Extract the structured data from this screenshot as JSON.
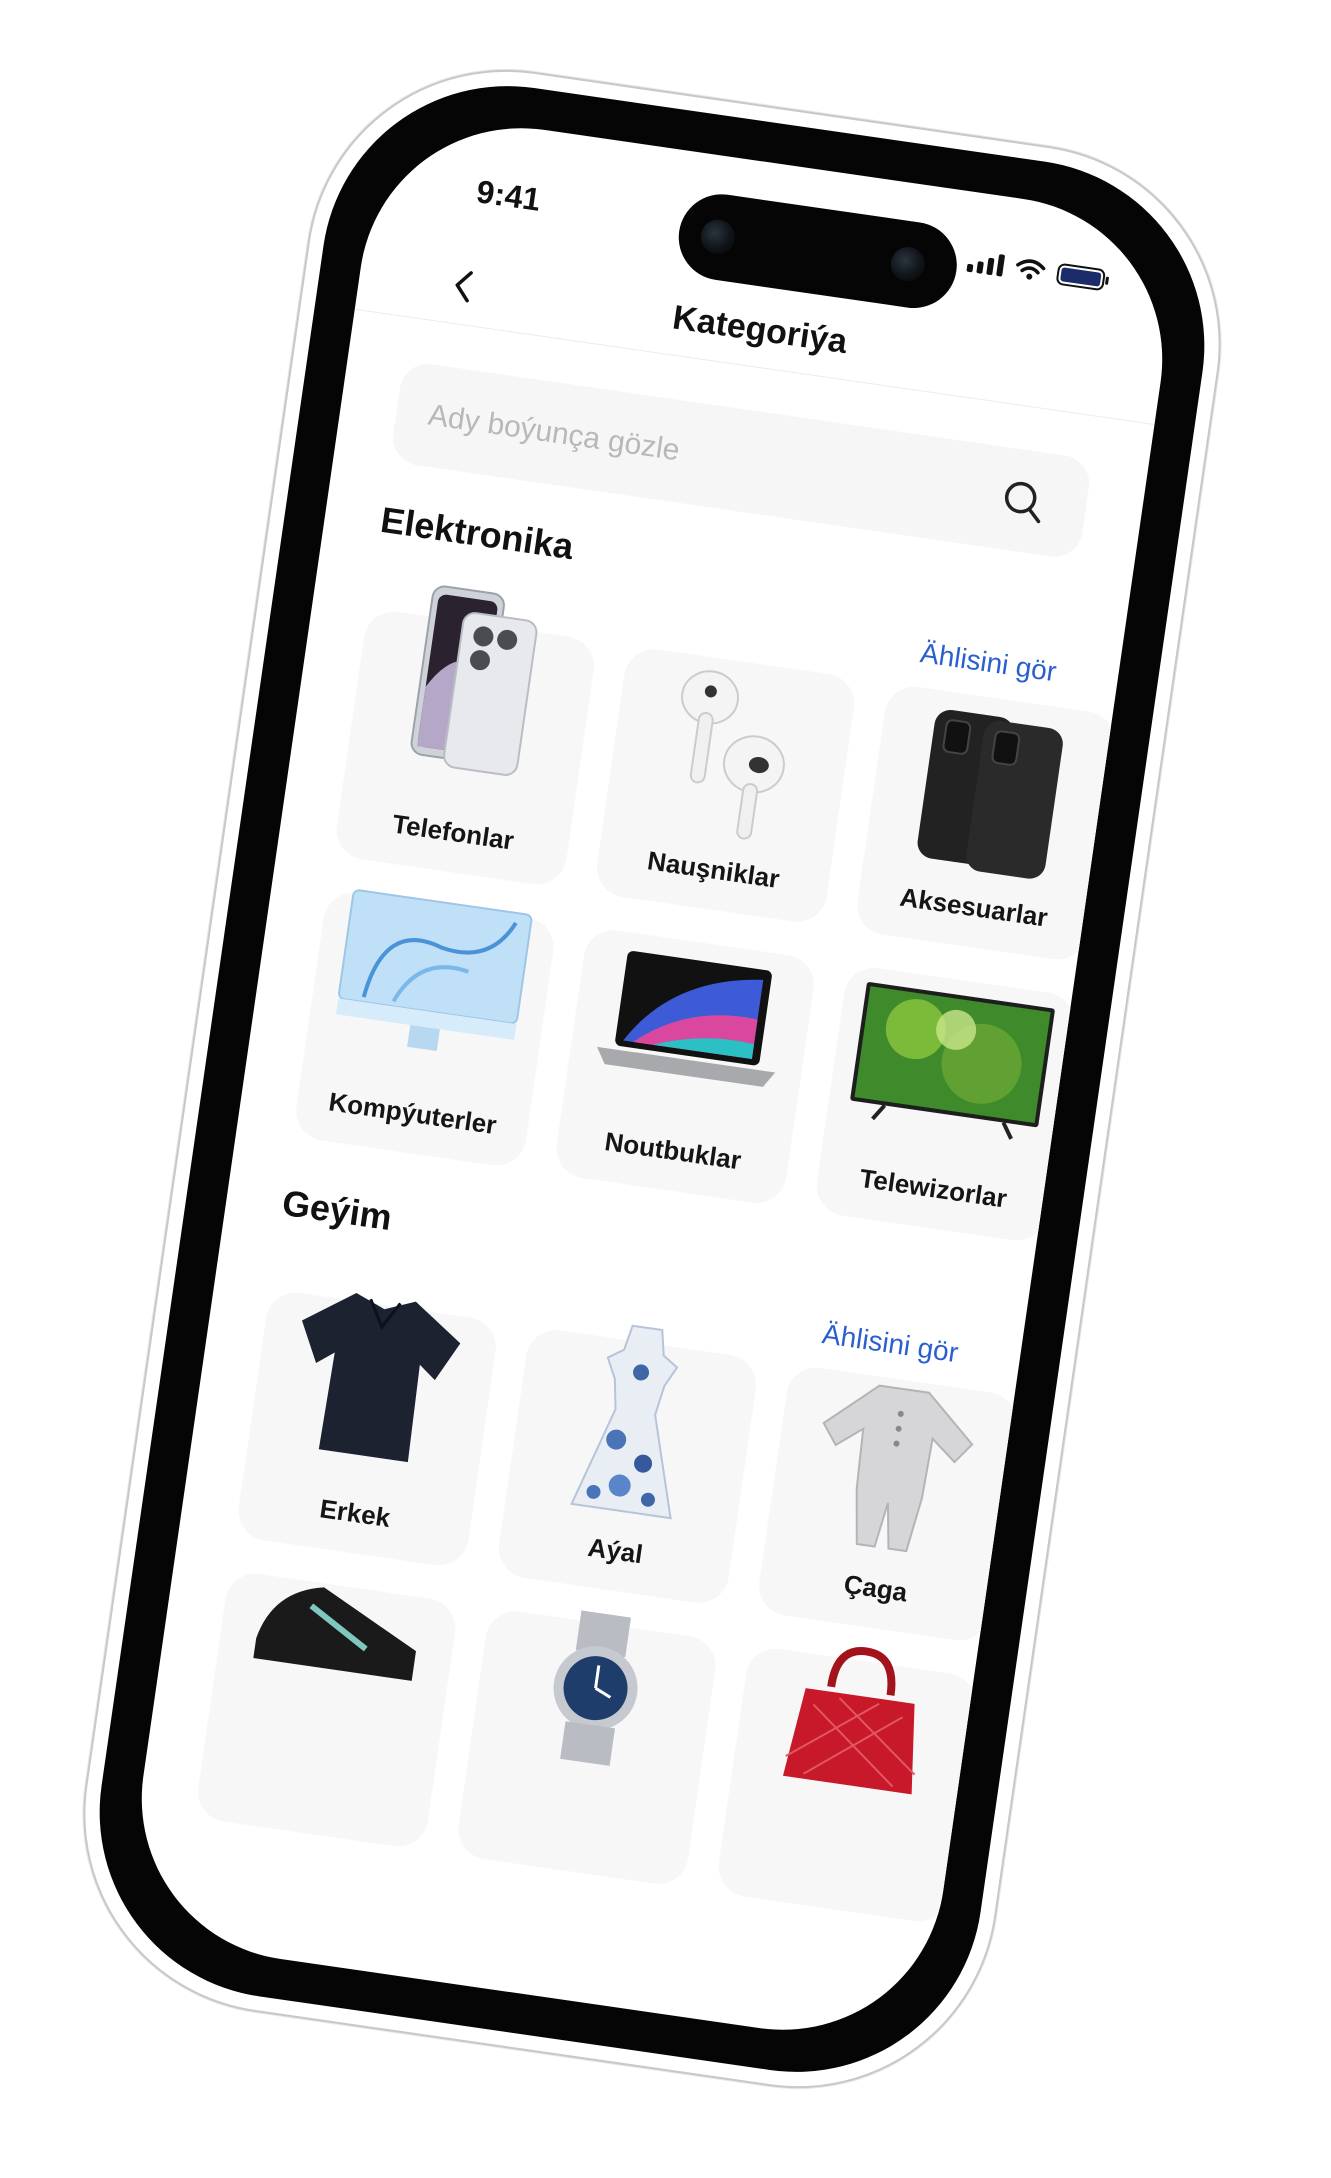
{
  "status_bar": {
    "time": "9:41"
  },
  "nav": {
    "title": "Kategoriýa",
    "back_icon": "chevron-left-icon"
  },
  "search": {
    "placeholder": "Ady boýunça gözle",
    "value": "",
    "icon": "search-icon"
  },
  "sections": [
    {
      "title": "Elektronika",
      "see_all": "Ählisini gör",
      "items": [
        {
          "label": "Telefonlar",
          "icon": "smartphone-image"
        },
        {
          "label": "Nauşniklar",
          "icon": "earbuds-image"
        },
        {
          "label": "Aksesuarlar",
          "icon": "phone-case-image"
        },
        {
          "label": "Kompýuterler",
          "icon": "desktop-computer-image"
        },
        {
          "label": "Noutbuklar",
          "icon": "laptop-image"
        },
        {
          "label": "Telewizorlar",
          "icon": "television-image"
        }
      ]
    },
    {
      "title": "Geýim",
      "see_all": "Ählisini gör",
      "items": [
        {
          "label": "Erkek",
          "icon": "polo-shirt-image"
        },
        {
          "label": "Aýal",
          "icon": "dress-image"
        },
        {
          "label": "Çaga",
          "icon": "baby-romper-image"
        },
        {
          "label": "",
          "icon": "sneaker-image"
        },
        {
          "label": "",
          "icon": "wristwatch-image"
        },
        {
          "label": "",
          "icon": "handbag-image"
        }
      ]
    }
  ],
  "colors": {
    "accent": "#2b5fd0",
    "card_bg": "#f7f7f7",
    "text": "#111111"
  }
}
